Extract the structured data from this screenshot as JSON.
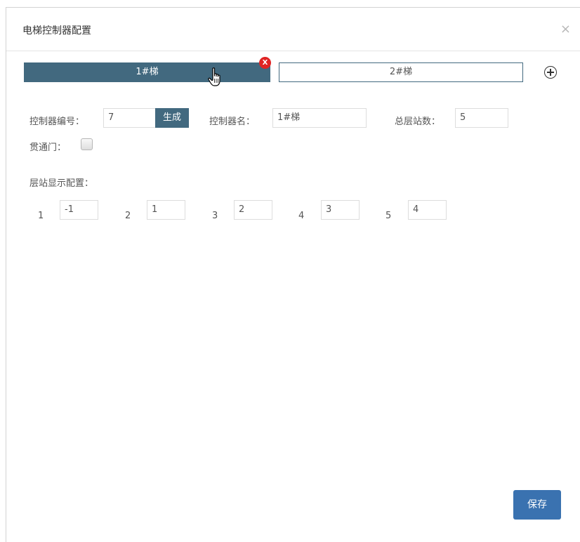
{
  "dialog": {
    "title": "电梯控制器配置",
    "close_glyph": "×"
  },
  "tabs": [
    {
      "label": "1#梯",
      "active": true,
      "remove_glyph": "X"
    },
    {
      "label": "2#梯",
      "active": false
    }
  ],
  "form": {
    "controller_no_label": "控制器编号：",
    "controller_no_value": "7",
    "generate_label": "生成",
    "controller_name_label": "控制器名：",
    "controller_name_value": "1#梯",
    "total_floors_label": "总层站数：",
    "total_floors_value": "5",
    "through_door_label": "贯通门：",
    "through_door_checked": false,
    "floor_display_label": "层站显示配置："
  },
  "floors": [
    {
      "index": "1",
      "display": "-1"
    },
    {
      "index": "2",
      "display": "1"
    },
    {
      "index": "3",
      "display": "2"
    },
    {
      "index": "4",
      "display": "3"
    },
    {
      "index": "5",
      "display": "4"
    }
  ],
  "footer": {
    "save_label": "保存"
  },
  "colors": {
    "primary": "#42697f",
    "save": "#3a72b0",
    "remove": "#e02424"
  },
  "icons": [
    "close-icon",
    "remove-tab-icon",
    "add-tab-icon",
    "hand-cursor-icon",
    "checkbox"
  ]
}
